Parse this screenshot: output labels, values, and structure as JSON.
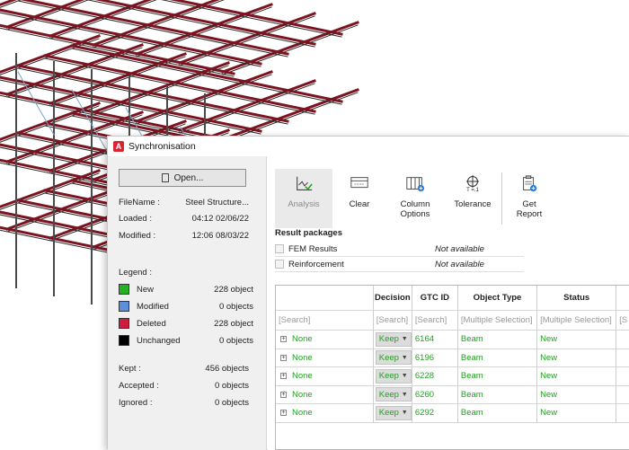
{
  "dialog": {
    "title": "Synchronisation",
    "app_icon_letter": "A"
  },
  "left": {
    "open_label": "Open...",
    "info": [
      {
        "label": "FileName :",
        "value": "Steel Structure..."
      },
      {
        "label": "Loaded :",
        "value": "04:12 02/06/22"
      },
      {
        "label": "Modified :",
        "value": "12:06 08/03/22"
      }
    ],
    "legend_title": "Legend :",
    "legend": [
      {
        "name": "New",
        "count": "228 object",
        "color": "#22b322"
      },
      {
        "name": "Modified",
        "count": "0 objects",
        "color": "#5b8fd9"
      },
      {
        "name": "Deleted",
        "count": "228 object",
        "color": "#d01c3c"
      },
      {
        "name": "Unchanged",
        "count": "0 objects",
        "color": "#000000"
      }
    ],
    "stats": [
      {
        "label": "Kept :",
        "value": "456 objects"
      },
      {
        "label": "Accepted :",
        "value": "0 objects"
      },
      {
        "label": "Ignored :",
        "value": "0 objects"
      }
    ]
  },
  "toolbar": {
    "analysis": "Analysis",
    "clear": "Clear",
    "column_options_1": "Column",
    "column_options_2": "Options",
    "tolerance": "Tolerance",
    "tolerance_icon_text": "T =.1",
    "get_report_1": "Get",
    "get_report_2": "Report"
  },
  "packages": {
    "title": "Result packages",
    "items": [
      {
        "name": "FEM Results",
        "status": "Not available"
      },
      {
        "name": "Reinforcement",
        "status": "Not available"
      }
    ]
  },
  "grid": {
    "headers": [
      "",
      "Decision",
      "GTC ID",
      "Object Type",
      "Status",
      ""
    ],
    "search": [
      "[Search]",
      "[Search]",
      "[Search]",
      "[Multiple Selection]",
      "[Multiple Selection]",
      "[S"
    ],
    "rows": [
      {
        "name": "None",
        "decision": "Keep",
        "id": "6164",
        "type": "Beam",
        "status": "New"
      },
      {
        "name": "None",
        "decision": "Keep",
        "id": "6196",
        "type": "Beam",
        "status": "New"
      },
      {
        "name": "None",
        "decision": "Keep",
        "id": "6228",
        "type": "Beam",
        "status": "New"
      },
      {
        "name": "None",
        "decision": "Keep",
        "id": "6260",
        "type": "Beam",
        "status": "New"
      }
    ],
    "partial_row": {
      "name": "None",
      "decision": "Keep",
      "id": "6292",
      "type": "Beam",
      "status": "New"
    }
  },
  "colors": {
    "accent": "#d7262f",
    "new_text": "#22a022",
    "beam_red": "#7a1420"
  }
}
